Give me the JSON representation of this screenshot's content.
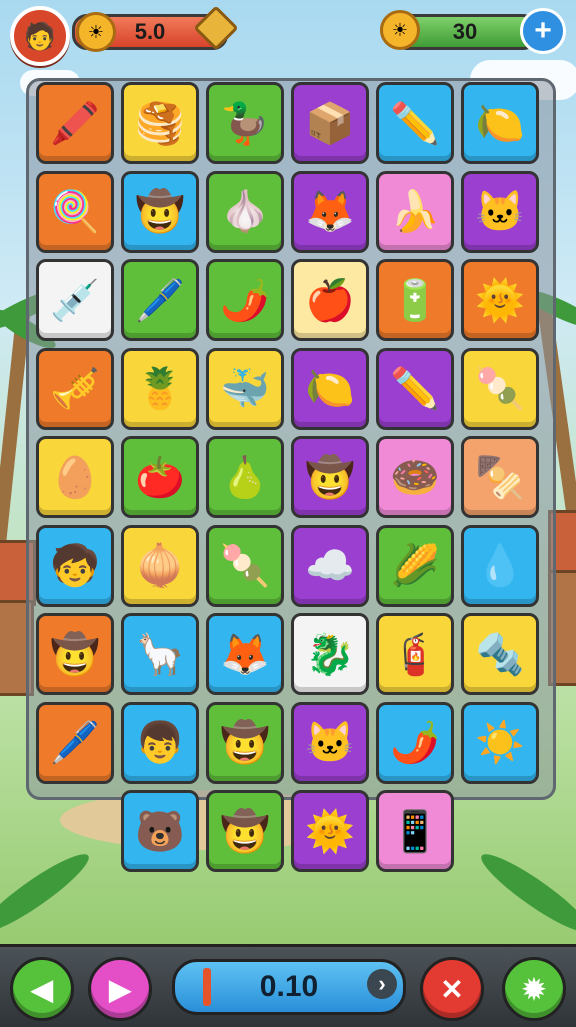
{
  "hud": {
    "avatar_icon": "🧑",
    "level_value": "5.0",
    "coins_value": "30",
    "plus_label": "+"
  },
  "board": {
    "tiles": [
      {
        "color": "orange",
        "icon": "🖍️"
      },
      {
        "color": "yellow",
        "icon": "🥞"
      },
      {
        "color": "green",
        "icon": "🦆"
      },
      {
        "color": "purple",
        "icon": "📦"
      },
      {
        "color": "blue",
        "icon": "✏️"
      },
      {
        "color": "blue",
        "icon": "🍋"
      },
      {
        "color": "orange",
        "icon": "🍭"
      },
      {
        "color": "blue",
        "icon": "🤠"
      },
      {
        "color": "green",
        "icon": "🧄"
      },
      {
        "color": "purple",
        "icon": "🦊"
      },
      {
        "color": "pink",
        "icon": "🍌"
      },
      {
        "color": "purple",
        "icon": "🐱"
      },
      {
        "color": "white",
        "icon": "💉"
      },
      {
        "color": "green",
        "icon": "🖊️"
      },
      {
        "color": "green",
        "icon": "🌶️"
      },
      {
        "color": "cream",
        "icon": "🍎"
      },
      {
        "color": "orange",
        "icon": "🔋"
      },
      {
        "color": "orange",
        "icon": "🌞"
      },
      {
        "color": "orange",
        "icon": "🎺"
      },
      {
        "color": "yellow",
        "icon": "🍍"
      },
      {
        "color": "yellow",
        "icon": "🐳"
      },
      {
        "color": "purple",
        "icon": "🍋"
      },
      {
        "color": "purple",
        "icon": "✏️"
      },
      {
        "color": "yellow",
        "icon": "🍡"
      },
      {
        "color": "yellow",
        "icon": "🥚"
      },
      {
        "color": "green",
        "icon": "🍅"
      },
      {
        "color": "green",
        "icon": "🍐"
      },
      {
        "color": "purple",
        "icon": "🤠"
      },
      {
        "color": "pink",
        "icon": "🍩"
      },
      {
        "color": "peach",
        "icon": "🍢"
      },
      {
        "color": "blue",
        "icon": "🧒"
      },
      {
        "color": "yellow",
        "icon": "🧅"
      },
      {
        "color": "green",
        "icon": "🍡"
      },
      {
        "color": "purple",
        "icon": "☁️"
      },
      {
        "color": "green",
        "icon": "🌽"
      },
      {
        "color": "blue",
        "icon": "💧"
      },
      {
        "color": "orange",
        "icon": "🤠"
      },
      {
        "color": "blue",
        "icon": "🦙"
      },
      {
        "color": "blue",
        "icon": "🦊"
      },
      {
        "color": "white",
        "icon": "🐉"
      },
      {
        "color": "yellow",
        "icon": "🧯"
      },
      {
        "color": "yellow",
        "icon": "🔩"
      },
      {
        "color": "orange",
        "icon": "🖊️"
      },
      {
        "color": "blue",
        "icon": "👦"
      },
      {
        "color": "green",
        "icon": "🤠"
      },
      {
        "color": "purple",
        "icon": "🐱"
      },
      {
        "color": "blue",
        "icon": "🌶️"
      },
      {
        "color": "blue",
        "icon": "☀️"
      },
      {
        "color": "blue",
        "icon": "🐻"
      },
      {
        "color": "green",
        "icon": "🤠"
      },
      {
        "color": "purple",
        "icon": "🌞"
      },
      {
        "color": "pink",
        "icon": "📱"
      }
    ]
  },
  "controls": {
    "prev_icon": "◀",
    "next_icon": "▶",
    "timer_value": "0.10",
    "timer_arrow": "›",
    "close_icon": "✕",
    "settings_icon": "✹"
  }
}
